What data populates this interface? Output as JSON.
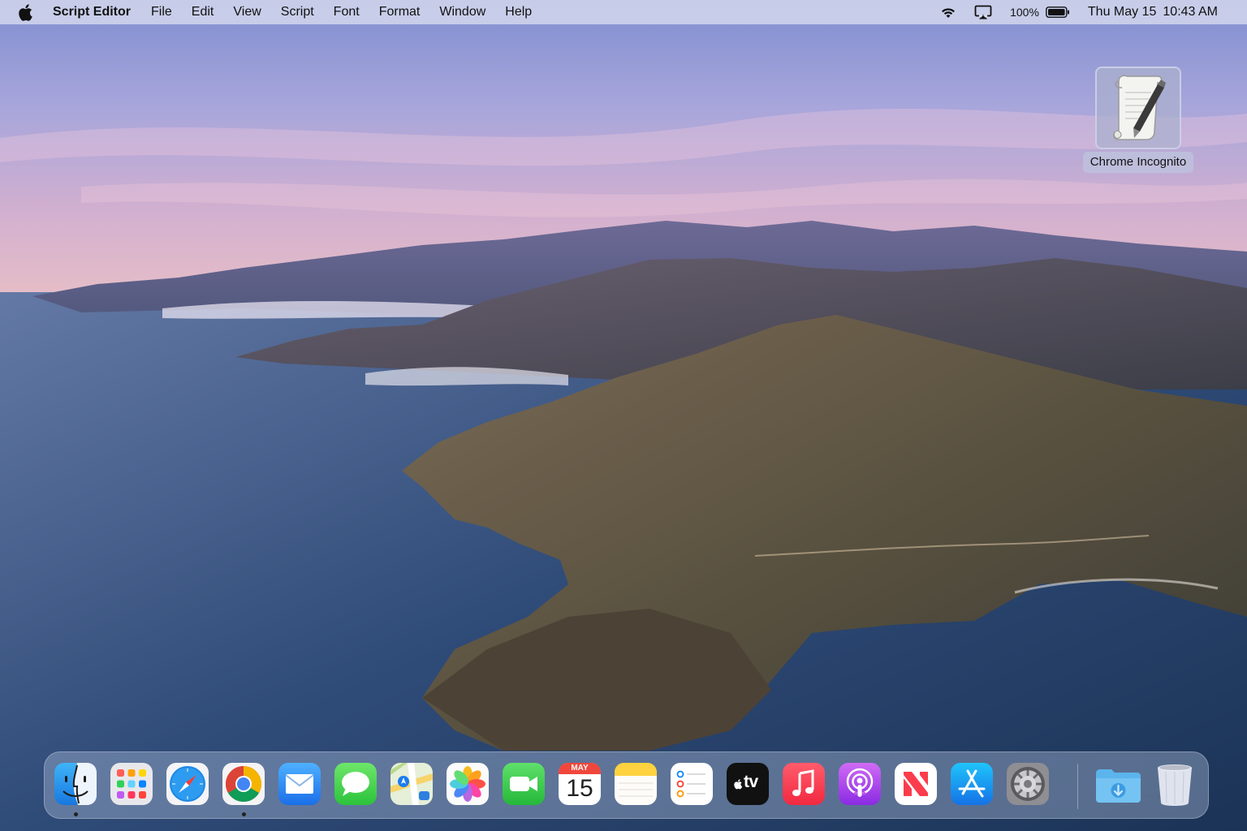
{
  "menubar": {
    "app_name": "Script Editor",
    "menus": [
      "File",
      "Edit",
      "View",
      "Script",
      "Font",
      "Format",
      "Window",
      "Help"
    ],
    "battery": "100%",
    "date": "Thu May 15",
    "time": "10:43 AM"
  },
  "desktop": {
    "icon_label": "Chrome Incognito",
    "icon_name": "script-editor-icon"
  },
  "dock": {
    "calendar_month": "MAY",
    "calendar_day": "15",
    "tv_label": "tv",
    "items": [
      "Finder",
      "Launchpad",
      "Safari",
      "Chrome",
      "Mail",
      "Messages",
      "Maps",
      "Photos",
      "FaceTime",
      "Calendar",
      "Notes",
      "Reminders",
      "TV",
      "Music",
      "Podcasts",
      "News",
      "App Store",
      "System Preferences",
      "Downloads",
      "Trash"
    ],
    "running": [
      "Finder",
      "Chrome"
    ]
  }
}
